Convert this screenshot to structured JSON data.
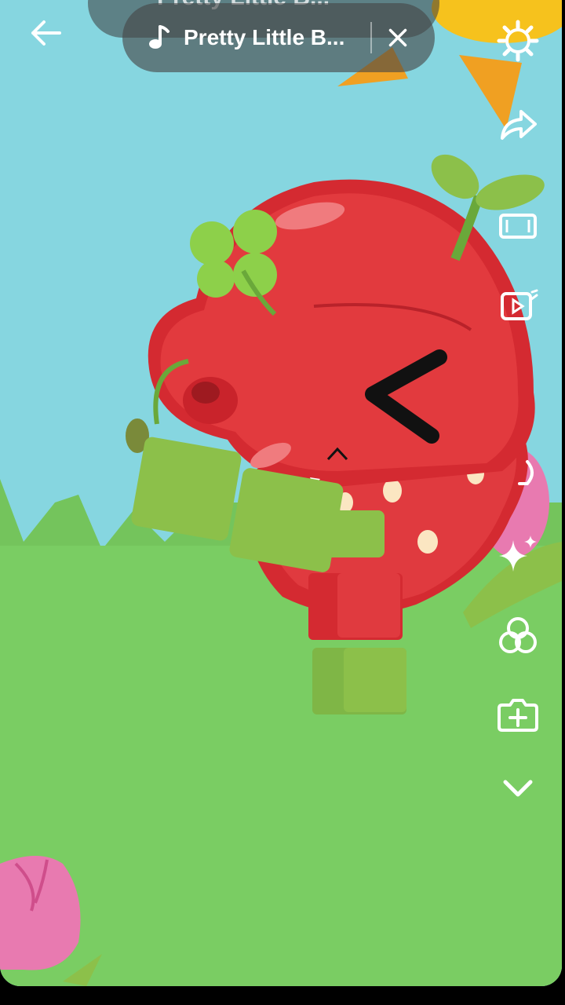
{
  "music": {
    "title": "Pretty Little B...",
    "ghost_title": "Pretty Little B..."
  },
  "toolbar": {
    "back": "back-arrow-icon",
    "close": "close-icon",
    "tools": [
      "settings-icon",
      "share-icon",
      "aspect-ratio-icon",
      "video-icon",
      "effects-icon",
      "sparkle-icon",
      "filters-icon",
      "add-clip-icon",
      "chevron-down-icon"
    ]
  },
  "colors": {
    "sky": "#86d6e0",
    "grass": "#7acd63",
    "strawberry": "#db3036",
    "leaf": "#8cc04a"
  }
}
